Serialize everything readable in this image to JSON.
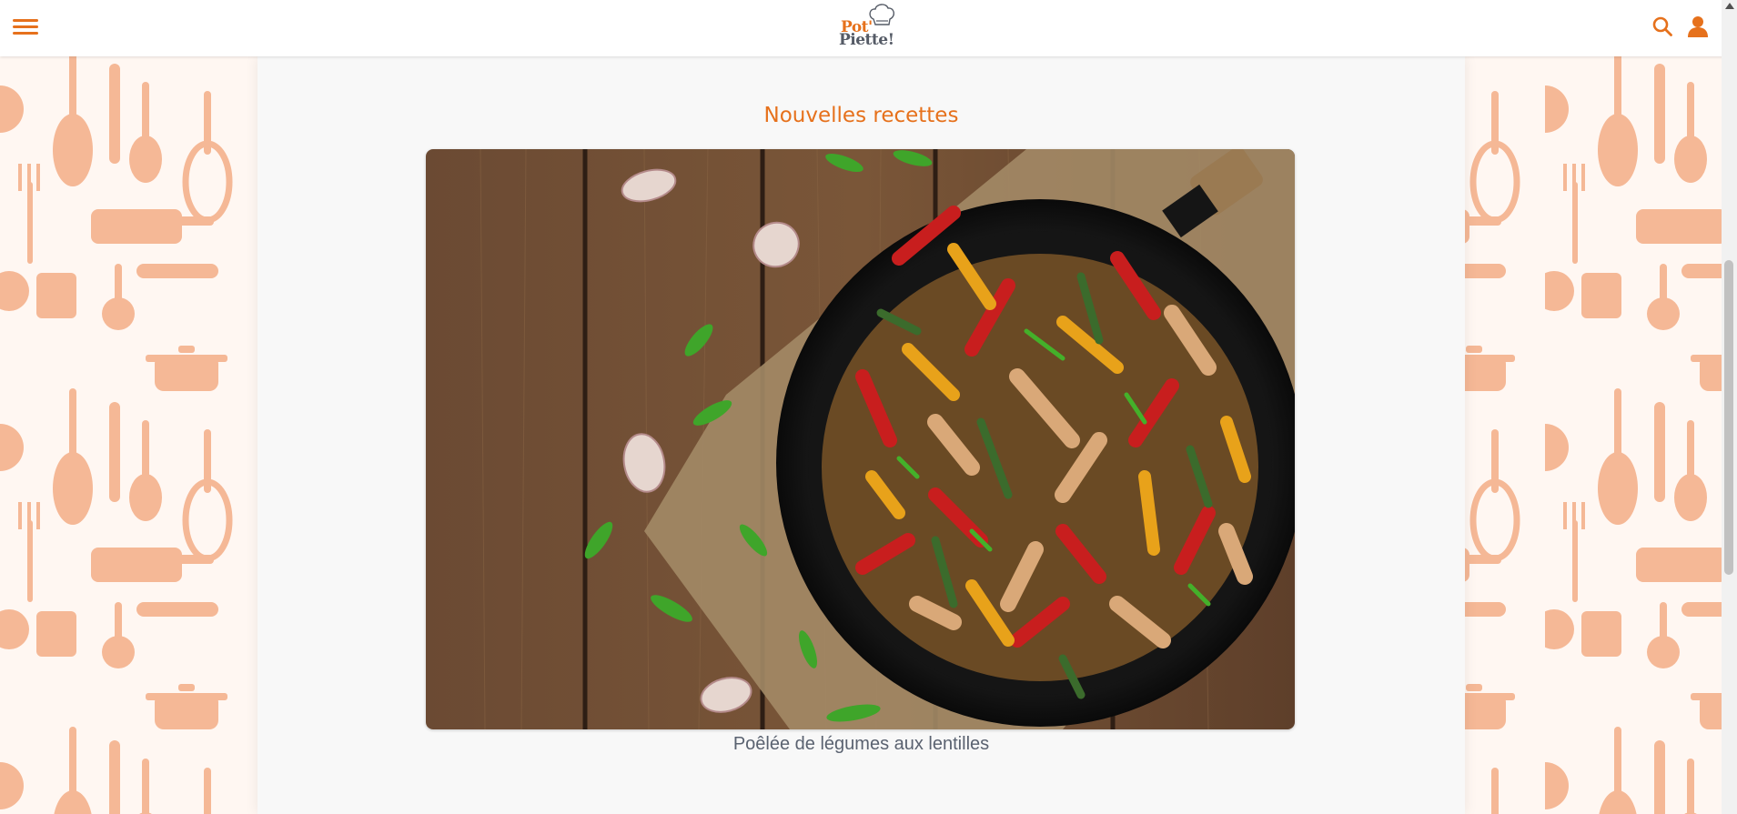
{
  "header": {
    "logo_line1": "Pot'",
    "logo_line2": "Piette!",
    "icons": [
      "hamburger-menu-icon",
      "search-icon",
      "user-icon"
    ]
  },
  "main": {
    "section_title": "Nouvelles recettes",
    "featured_recipe": {
      "name": "Poêlée de légumes aux lentilles"
    }
  },
  "colors": {
    "accent": "#e6711c",
    "pattern": "#f5b896",
    "text_muted": "#5a6270",
    "content_bg": "#f8f8f8"
  }
}
